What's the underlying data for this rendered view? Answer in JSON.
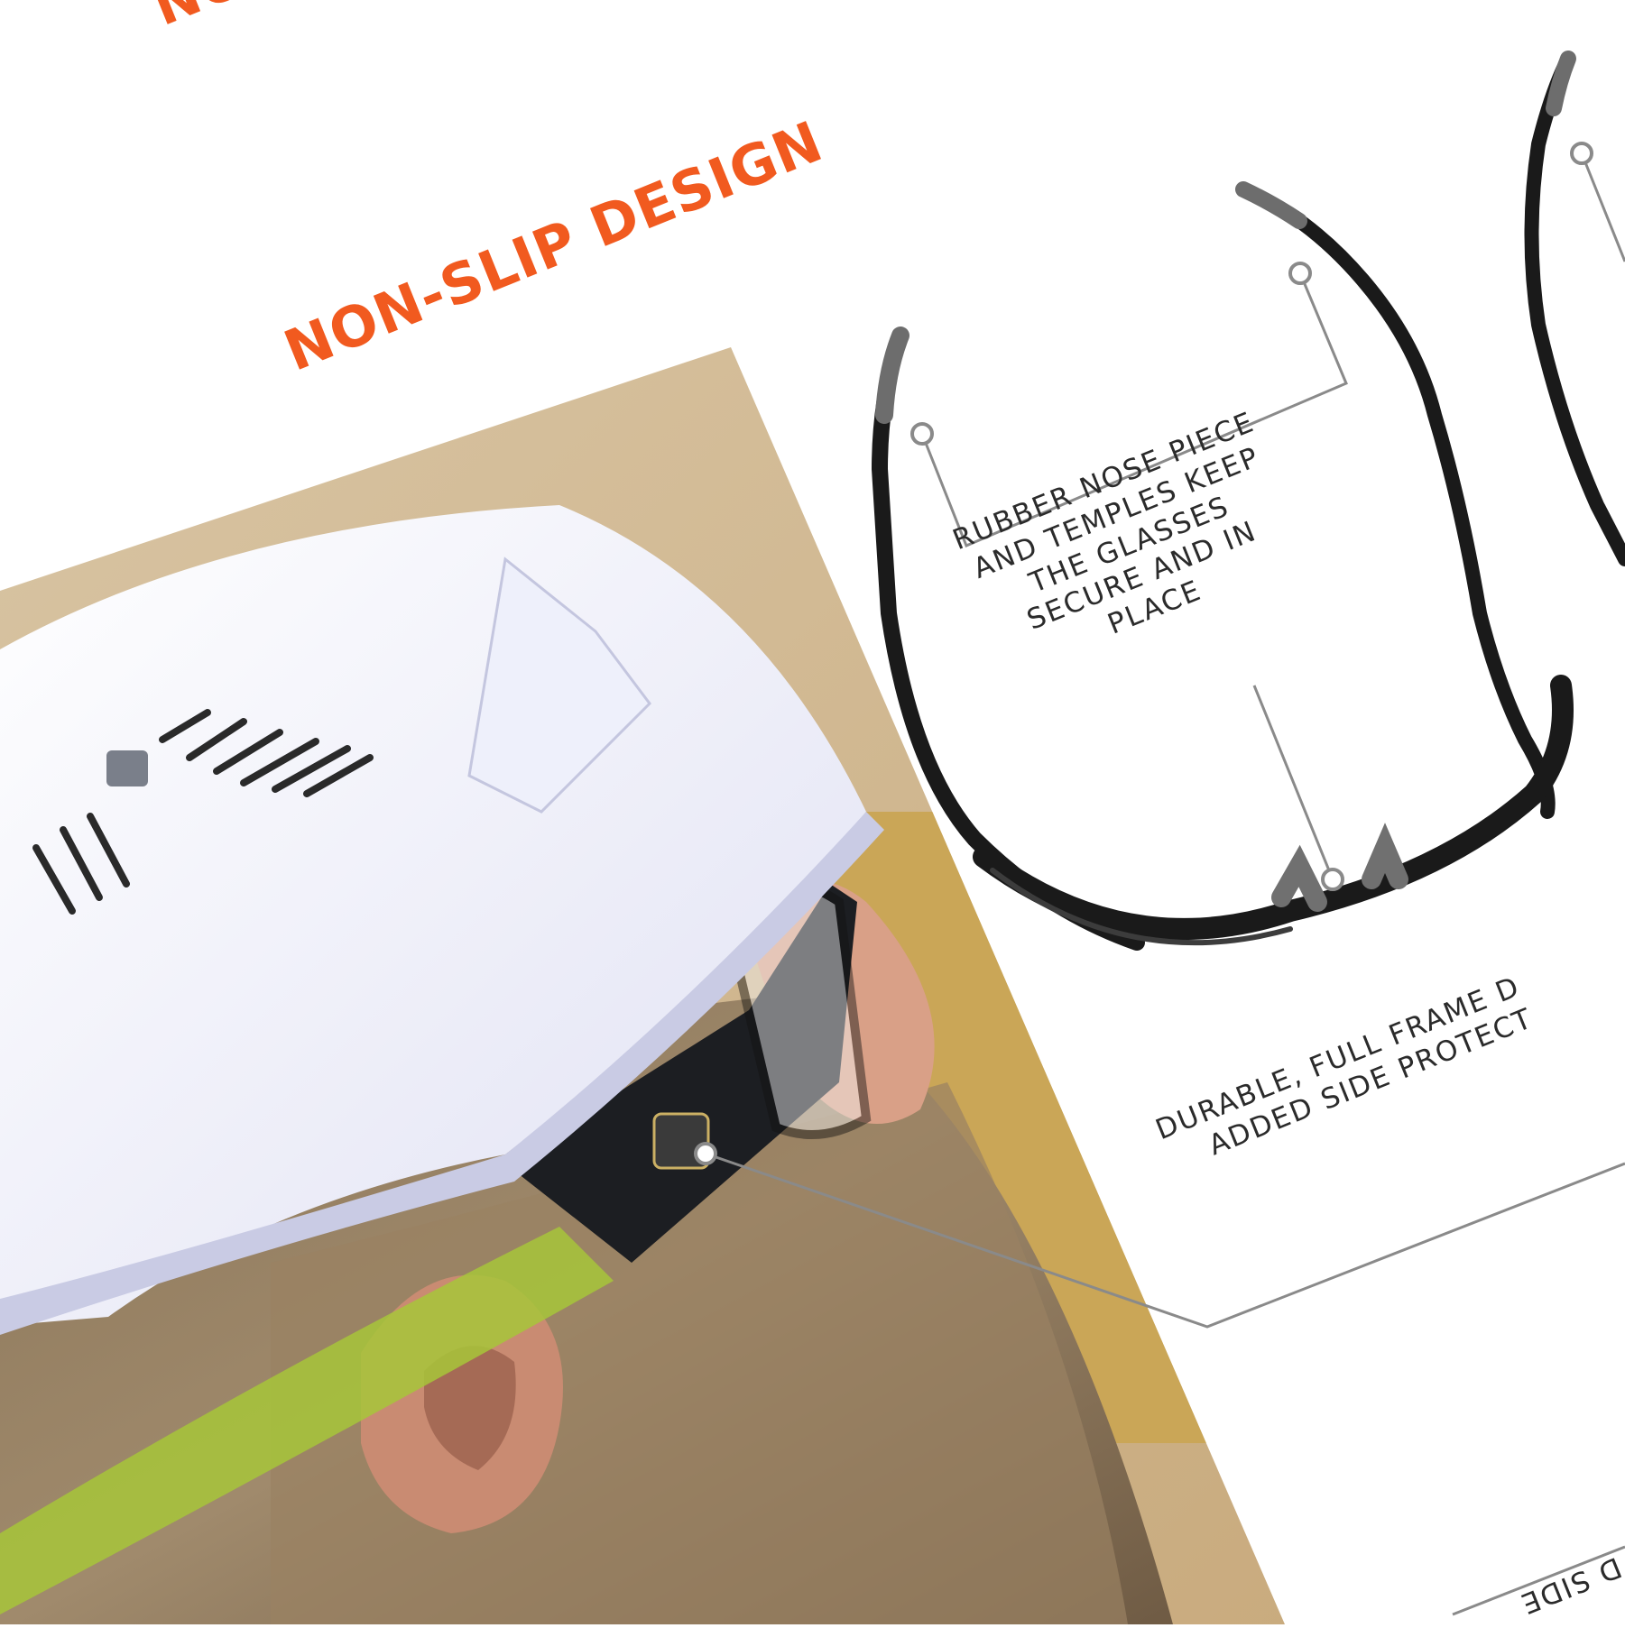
{
  "page": {
    "top_heading_fragment": "NO",
    "heading": "NON-SLIP DESIGN",
    "accent_color": "#f15a1f",
    "text_color": "#2b2b2b",
    "leader_line_color": "#8a8a8a"
  },
  "callouts": {
    "nose_piece": {
      "lines": [
        "RUBBER NOSE PIECE",
        "AND TEMPLES KEEP",
        "THE GLASSES",
        "SECURE AND IN",
        "PLACE"
      ]
    },
    "full_frame": {
      "lines": [
        "DURABLE, FULL FRAME D",
        "ADDED SIDE PROTECT"
      ]
    },
    "bottom_fragment": "D SIDE"
  },
  "images": {
    "photo": "worker-in-white-hard-hat-wearing-safety-glasses",
    "product": "black-safety-glasses-frame-top-view"
  }
}
